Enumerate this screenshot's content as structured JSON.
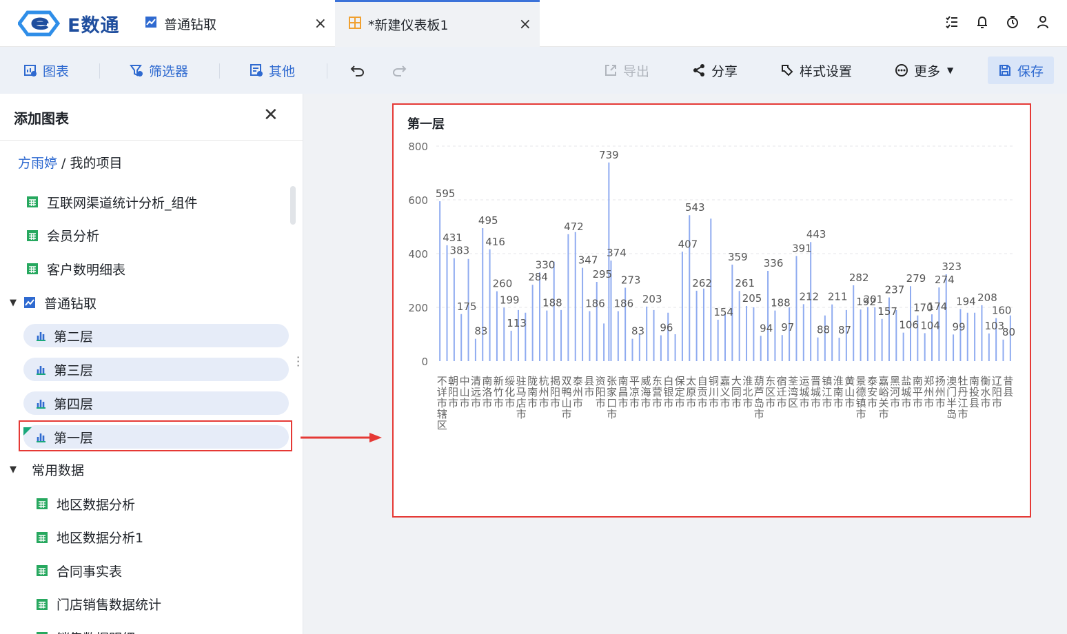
{
  "app": {
    "logo_text": "E数通",
    "tabs": [
      {
        "label": "普通钻取",
        "close": "×"
      },
      {
        "label": "*新建仪表板1",
        "close": "×"
      }
    ]
  },
  "toolbar": {
    "chart": "图表",
    "filter": "筛选器",
    "other": "其他",
    "export": "导出",
    "share": "分享",
    "style": "样式设置",
    "more": "更多",
    "save": "保存"
  },
  "sidebar": {
    "title": "添加图表",
    "breadcrumb_user": "方雨婷",
    "breadcrumb_sep": " / ",
    "breadcrumb_project": "我的项目",
    "top_items": [
      "互联网渠道统计分析_组件",
      "会员分析",
      "客户数明细表"
    ],
    "folder1": "普通钻取",
    "folder1_items": [
      "第二层",
      "第三层",
      "第四层",
      "第一层"
    ],
    "folder2": "常用数据",
    "folder2_items": [
      "地区数据分析",
      "地区数据分析1",
      "合同事实表",
      "门店销售数据统计",
      "销售数据明细"
    ]
  },
  "colors": {
    "accent": "#2f6ad0",
    "bar": "#8fabf0",
    "highlight": "#e53935",
    "table_icon": "#27a85f"
  },
  "chart_data": {
    "type": "bar",
    "title": "第一层",
    "ylim": [
      0,
      800
    ],
    "yticks": [
      0,
      200,
      400,
      600,
      800
    ],
    "grid": true,
    "categories": [
      "不详市辖区",
      "朝阳市",
      "中山市",
      "清远市",
      "南洛市",
      "新竹市",
      "绥化市",
      "驻马店市",
      "陇南市",
      "杭州市",
      "揭阳市",
      "双鸭山市",
      "泰州市",
      "县市",
      "资阳市",
      "张家口市",
      "南昌市",
      "平凉市",
      "威海市",
      "东营市",
      "白银市",
      "保定市",
      "太原市",
      "自贡市",
      "铜川市",
      "嘉义市",
      "大同市",
      "淮北市",
      "葫芦岛市",
      "东区市",
      "宿迁市",
      "荃湾区",
      "运城市",
      "晋城市",
      "镇江市",
      "淮南市",
      "黄山市",
      "景德镇市",
      "泰安市",
      "嘉峪关市",
      "黑河市",
      "盐城市",
      "南平市",
      "郑州市",
      "扬州市",
      "澳门半岛",
      "牡丹江市",
      "南投县",
      "衡水市",
      "辽阳市",
      "昔县"
    ],
    "values": [
      595,
      431,
      383,
      175,
      380,
      83,
      495,
      416,
      260,
      199,
      113,
      190,
      180,
      284,
      330,
      188,
      370,
      190,
      472,
      480,
      347,
      186,
      295,
      140,
      374,
      186,
      273,
      83,
      100,
      203,
      190,
      96,
      180,
      100,
      407,
      543,
      262,
      270,
      530,
      154,
      175,
      359,
      261,
      205,
      200,
      94,
      336,
      188,
      97,
      200,
      391,
      212,
      443,
      88,
      170,
      211,
      87,
      190,
      282,
      192,
      201,
      200,
      157,
      237,
      190,
      106,
      279,
      170,
      104,
      174,
      274,
      323,
      99,
      194,
      180,
      180,
      208,
      103,
      160,
      80,
      170
    ],
    "labels": [
      "595",
      "431",
      "383",
      "175",
      "83",
      "495",
      "416",
      "260",
      "199",
      "113",
      "284",
      "330",
      "188",
      "472",
      "347",
      "186",
      "295",
      "374",
      "186",
      "273",
      "83",
      "203",
      "96",
      "407",
      "543",
      "262",
      "154",
      "359",
      "261",
      "205",
      "94",
      "336",
      "188",
      "97",
      "391",
      "212",
      "443",
      "88",
      "211",
      "87",
      "282",
      "192",
      "201",
      "157",
      "237",
      "106",
      "279",
      "170",
      "104",
      "174",
      "274",
      "323",
      "99",
      "194",
      "208",
      "103",
      "160",
      "80",
      "739"
    ]
  }
}
